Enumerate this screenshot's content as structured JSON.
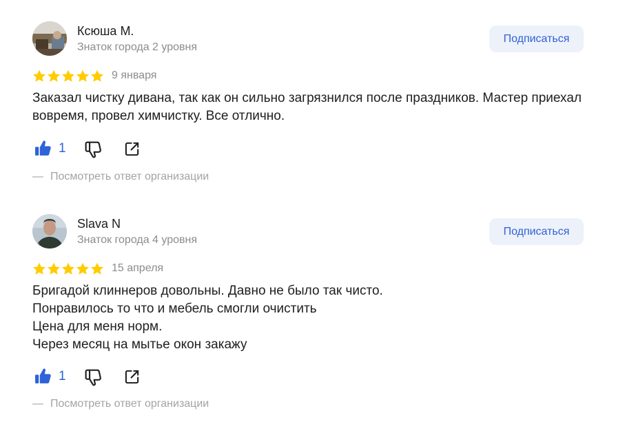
{
  "reviews": [
    {
      "author": "Ксюша М.",
      "level": "Знаток города 2 уровня",
      "subscribe_label": "Подписаться",
      "rating": 5,
      "date": "9 января",
      "text": "Заказал чистку дивана, так как он сильно загрязнился после праздников. Мастер приехал вовремя, провел химчистку. Все отлично.",
      "likes": "1",
      "org_answer_label": "Посмотреть ответ организации",
      "org_answer_dash": "—"
    },
    {
      "author": "Slava N",
      "level": "Знаток города 4 уровня",
      "subscribe_label": "Подписаться",
      "rating": 5,
      "date": "15 апреля",
      "text": "Бригадой клиннеров довольны. Давно не было так чисто.\nПонравилось то что и мебель смогли очистить\nЦена для меня норм.\nЧерез месяц на мытье окон закажу",
      "likes": "1",
      "org_answer_label": "Посмотреть ответ организации",
      "org_answer_dash": "—"
    }
  ],
  "colors": {
    "star": "#fc0",
    "accent": "#2d62d8",
    "button_bg": "#edf1fa",
    "muted": "#8c8c8c"
  },
  "icons": {
    "like": "thumbs-up-icon",
    "dislike": "thumbs-down-icon",
    "share": "share-icon"
  }
}
